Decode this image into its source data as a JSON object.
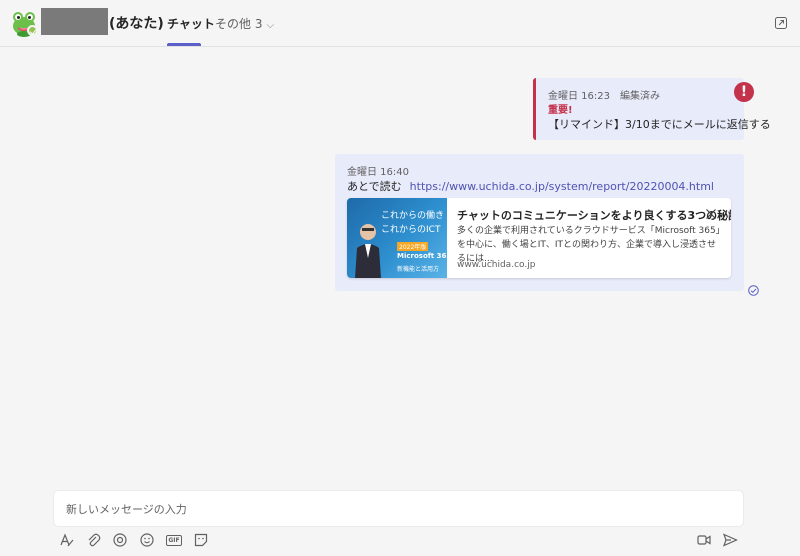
{
  "header": {
    "you_label": "(あなた)",
    "tabs": [
      {
        "label": "チャット"
      },
      {
        "label": "その他 3"
      }
    ]
  },
  "messages": [
    {
      "time": "金曜日 16:23　編集済み",
      "importance": "重要!",
      "body": "【リマインド】3/10までにメールに返信する"
    },
    {
      "time": "金曜日 16:40",
      "text": "あとで読む",
      "link": "https://www.uchida.co.jp/system/report/20220004.html",
      "preview": {
        "title": "チャットのコミュニケーションをより良くする3つの秘訣 ...",
        "description": "多くの企業で利用されているクラウドサービス「Microsoft 365」を中心に、働く場とIT、ITとの関わり方、企業で導入し浸透させるには...",
        "domain": "www.uchida.co.jp",
        "thumb_line1": "これからの働き",
        "thumb_line2": "これからのICT",
        "thumb_badge": "2022年版",
        "thumb_product": "Microsoft 365",
        "thumb_sub": "新機能と活用方"
      }
    }
  ],
  "composer": {
    "placeholder": "新しいメッセージの入力"
  },
  "colors": {
    "accent": "#5b5fc7",
    "important": "#c4314b",
    "bubble": "#e8ebfa",
    "presence": "#92c353"
  }
}
